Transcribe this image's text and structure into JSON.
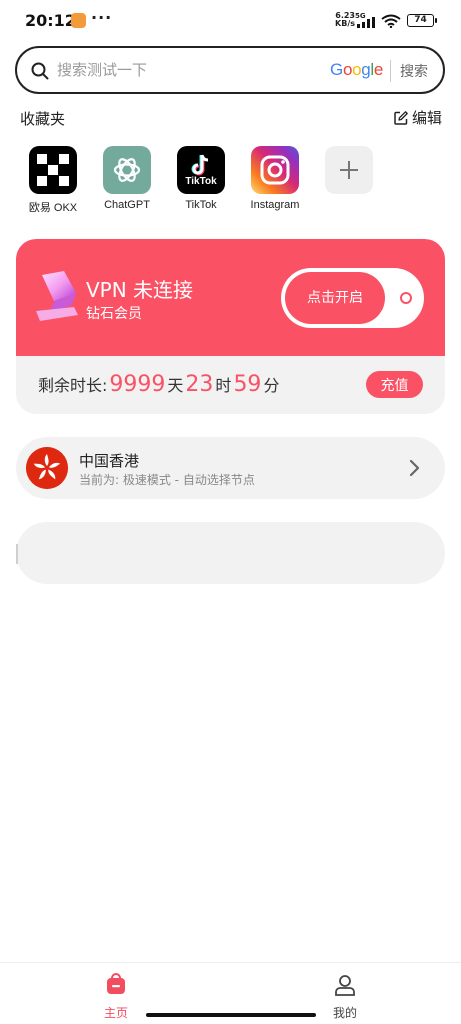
{
  "status_bar": {
    "time": "20:12",
    "more": "···",
    "speed_value": "6.23",
    "speed_unit": "KB/s",
    "network": "5G",
    "battery": "74"
  },
  "search": {
    "placeholder": "搜索测试一下",
    "engine": [
      "G",
      "o",
      "o",
      "g",
      "l",
      "e"
    ],
    "engine_colors": [
      "#4285F4",
      "#EA4335",
      "#FBBC05",
      "#4285F4",
      "#34A853",
      "#EA4335"
    ],
    "button": "搜索"
  },
  "favorites": {
    "title": "收藏夹",
    "edit": "编辑",
    "apps": [
      {
        "label": "欧易 OKX",
        "icon": "okx-icon"
      },
      {
        "label": "ChatGPT",
        "icon": "chatgpt-icon"
      },
      {
        "label": "TikTok",
        "icon": "tiktok-icon",
        "icon_text": "TikTok"
      },
      {
        "label": "Instagram",
        "icon": "instagram-icon"
      },
      {
        "label": "",
        "icon": "add-icon"
      }
    ]
  },
  "vpn": {
    "status": "VPN 未连接",
    "tier": "钻石会员",
    "toggle_label": "点击开启",
    "remaining": {
      "prefix": "剩余时长:",
      "days": "9999",
      "days_unit": "天",
      "hours": "23",
      "hours_unit": "时",
      "minutes": "59",
      "minutes_unit": "分"
    },
    "recharge": "充值",
    "accent": "#fb5165"
  },
  "server": {
    "name": "中国香港",
    "mode": "当前为: 极速模式 - 自动选择节点"
  },
  "nav": {
    "home": "主页",
    "mine": "我的",
    "active_color": "#f24d5e"
  }
}
